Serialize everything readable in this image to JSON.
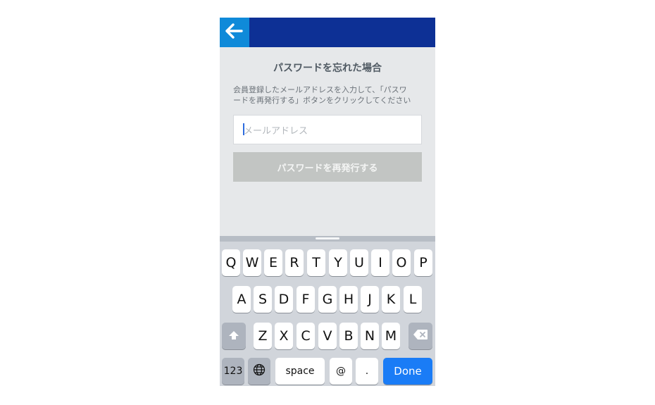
{
  "header": {
    "back_icon": "arrow-left-icon"
  },
  "page": {
    "title": "パスワードを忘れた場合",
    "description_line1": "会員登録したメールアドレスを入力して、「パスワ",
    "description_line2": "ードを再発行する」ボタンをクリックしてください",
    "email_placeholder": "メールアドレス",
    "submit_label": "パスワードを再発行する"
  },
  "keyboard": {
    "row1": [
      "Q",
      "W",
      "E",
      "R",
      "T",
      "Y",
      "U",
      "I",
      "O",
      "P"
    ],
    "row2": [
      "A",
      "S",
      "D",
      "F",
      "G",
      "H",
      "J",
      "K",
      "L"
    ],
    "row3": [
      "Z",
      "X",
      "C",
      "V",
      "B",
      "N",
      "M"
    ],
    "bottom": {
      "numbers": "123",
      "space": "space",
      "at": "@",
      "dot": ".",
      "done": "Done"
    }
  },
  "colors": {
    "navbar": "#0d3095",
    "back_button": "#0f8ad9",
    "done_key": "#1a7cf6"
  }
}
